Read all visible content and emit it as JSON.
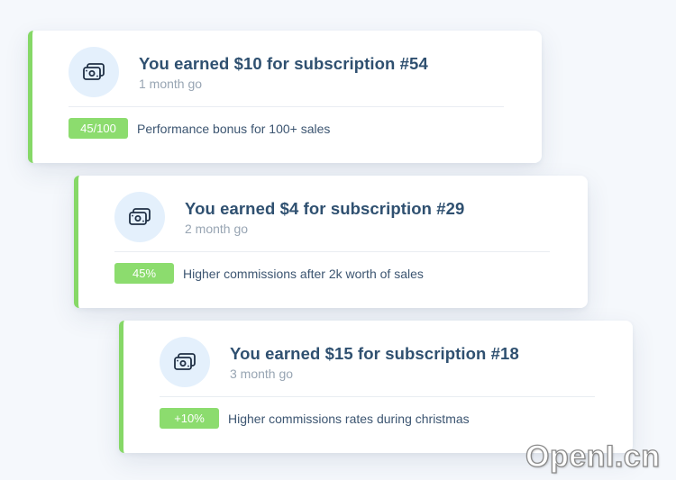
{
  "cards": [
    {
      "title": "You earned $10 for subscription #54",
      "time": "1 month go",
      "badge": "45/100",
      "description": "Performance bonus for 100+ sales",
      "icon": "money-icon"
    },
    {
      "title": "You earned $4 for subscription #29",
      "time": "2 month go",
      "badge": "45%",
      "description": "Higher commissions after 2k worth of sales",
      "icon": "money-icon"
    },
    {
      "title": "You earned $15 for subscription #18",
      "time": "3 month go",
      "badge": "+10%",
      "description": "Higher commissions rates during christmas",
      "icon": "money-icon"
    }
  ],
  "watermark": "OpenI.cn",
  "colors": {
    "accent_green": "#86d867",
    "badge_green": "#8cdc6e",
    "title_navy": "#2f5070",
    "muted_gray": "#98a5b3",
    "icon_bg": "#e4f0fc",
    "background": "#f5f8fc"
  }
}
